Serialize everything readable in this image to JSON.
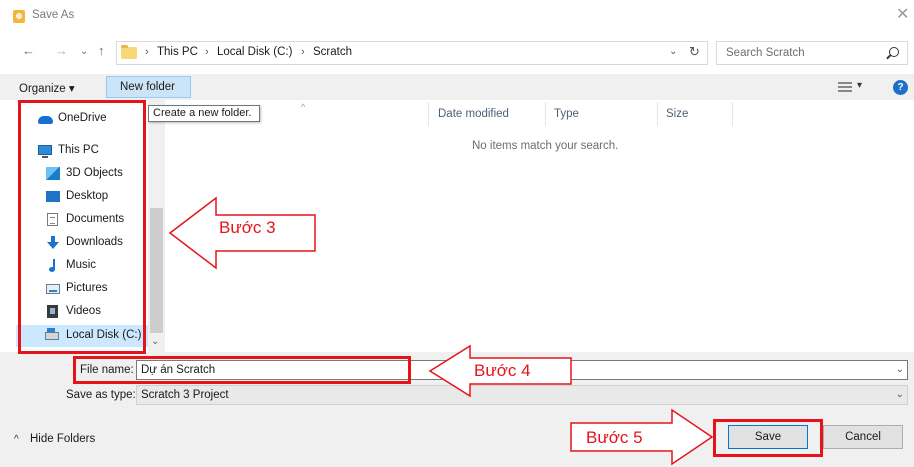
{
  "window": {
    "title": "Save As",
    "close_glyph": "✕"
  },
  "nav_buttons": {
    "back": "←",
    "forward": "→",
    "recent": "⌄",
    "up": "↑"
  },
  "address": {
    "crumbs": [
      "This PC",
      "Local Disk (C:)",
      "Scratch"
    ],
    "separator": "›",
    "dropdown": "⌄",
    "refresh": "↻"
  },
  "search": {
    "placeholder": "Search Scratch"
  },
  "toolbar": {
    "organize_label": "Organize ▾",
    "new_folder_label": "New folder",
    "view_dropdown": "▾",
    "help_label": "?"
  },
  "tooltip": {
    "text": "Create a new folder."
  },
  "sidebar": {
    "items": [
      {
        "label": "OneDrive",
        "icon": "onedrive-icon"
      },
      {
        "label": "This PC",
        "icon": "computer-icon"
      },
      {
        "label": "3D Objects",
        "icon": "3d-objects-icon"
      },
      {
        "label": "Desktop",
        "icon": "desktop-icon"
      },
      {
        "label": "Documents",
        "icon": "documents-icon"
      },
      {
        "label": "Downloads",
        "icon": "downloads-icon"
      },
      {
        "label": "Music",
        "icon": "music-icon"
      },
      {
        "label": "Pictures",
        "icon": "pictures-icon"
      },
      {
        "label": "Videos",
        "icon": "videos-icon"
      },
      {
        "label": "Local Disk (C:)",
        "icon": "local-disk-icon",
        "selected": true
      }
    ]
  },
  "file_list": {
    "sort_arrow": "^",
    "columns": [
      "Date modified",
      "Type",
      "Size"
    ],
    "empty_message": "No items match your search."
  },
  "form": {
    "file_name_label": "File name:",
    "file_name_value": "Dự án Scratch",
    "save_type_label": "Save as type:",
    "save_type_value": "Scratch 3 Project",
    "dropdown_glyph": "⌄"
  },
  "footer": {
    "hide_folders_label": "Hide Folders",
    "hide_folders_chevron": "^",
    "save_label": "Save",
    "cancel_label": "Cancel"
  },
  "annotations": {
    "step3": "Bước 3",
    "step4": "Bước 4",
    "step5": "Bước 5",
    "color": "#e5141b"
  },
  "colors": {
    "accent": "#0078d7",
    "selection": "#cce8ff",
    "new_folder_bg": "#cce4f7",
    "annotation_red": "#e5141b"
  }
}
